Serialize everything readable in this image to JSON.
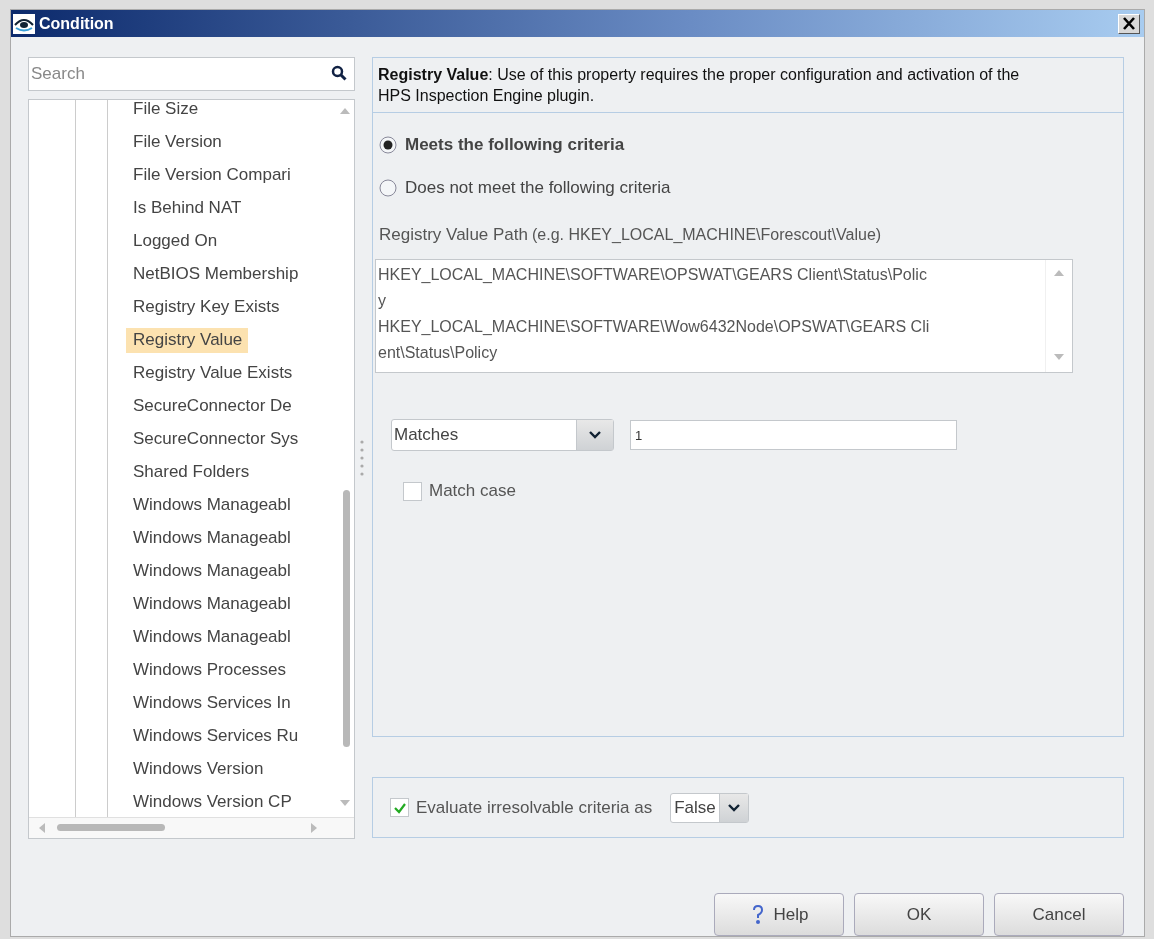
{
  "window": {
    "title": "Condition"
  },
  "search": {
    "placeholder": "Search"
  },
  "tree": {
    "items": [
      {
        "label": "File Size",
        "selected": false
      },
      {
        "label": "File Version",
        "selected": false
      },
      {
        "label": "File Version Compari",
        "selected": false
      },
      {
        "label": "Is Behind NAT",
        "selected": false
      },
      {
        "label": "Logged On",
        "selected": false
      },
      {
        "label": "NetBIOS Membership",
        "selected": false
      },
      {
        "label": "Registry Key Exists",
        "selected": false
      },
      {
        "label": "Registry Value",
        "selected": true
      },
      {
        "label": "Registry Value Exists",
        "selected": false
      },
      {
        "label": "SecureConnector De",
        "selected": false
      },
      {
        "label": "SecureConnector Sys",
        "selected": false
      },
      {
        "label": "Shared Folders",
        "selected": false
      },
      {
        "label": "Windows Manageabl",
        "selected": false
      },
      {
        "label": "Windows Manageabl",
        "selected": false
      },
      {
        "label": "Windows Manageabl",
        "selected": false
      },
      {
        "label": "Windows Manageabl",
        "selected": false
      },
      {
        "label": "Windows Manageabl",
        "selected": false
      },
      {
        "label": "Windows Processes",
        "selected": false
      },
      {
        "label": "Windows Services In",
        "selected": false
      },
      {
        "label": "Windows Services Ru",
        "selected": false
      },
      {
        "label": "Windows Version",
        "selected": false
      },
      {
        "label": "Windows Version CP",
        "selected": false
      }
    ]
  },
  "info": "**Registry Value**: Use of this property requires the proper configuration and activation of the HPS Inspection Engine plugin.",
  "criteria": [
    {
      "label": "Meets the following criteria",
      "selected": true
    },
    {
      "label": "Does not meet the following criteria",
      "selected": false
    }
  ],
  "path_label": "Registry Value Path",
  "path_hint": "(e.g. HKEY_LOCAL_MACHINE\\Forescout\\Value)",
  "path_lines": [
    "HKEY_LOCAL_MACHINE\\SOFTWARE\\OPSWAT\\GEARS Client\\Status\\Polic",
    "y",
    "HKEY_LOCAL_MACHINE\\SOFTWARE\\Wow6432Node\\OPSWAT\\GEARS Cli",
    "ent\\Status\\Policy"
  ],
  "operator": "Matches",
  "value": "1",
  "match_case": {
    "label": "Match case",
    "checked": false
  },
  "evaluate": {
    "label": "Evaluate irresolvable criteria as",
    "checked": true,
    "value": "False"
  },
  "buttons": [
    {
      "label": "Help",
      "kind": "help"
    },
    {
      "label": "OK",
      "kind": "plain"
    },
    {
      "label": "Cancel",
      "kind": "plain"
    }
  ]
}
